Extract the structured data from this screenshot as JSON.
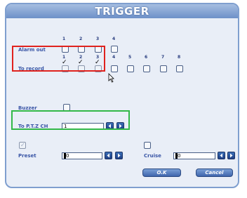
{
  "dialog": {
    "title": "TRIGGER"
  },
  "alarm_out": {
    "label": "Alarm out",
    "channels": [
      "1",
      "2",
      "3",
      "4"
    ]
  },
  "to_record": {
    "label": "To record",
    "channels": [
      "1",
      "2",
      "3",
      "4",
      "5",
      "6",
      "7",
      "8"
    ],
    "checked": [
      "1",
      "2",
      "3"
    ]
  },
  "buzzer": {
    "label": "Buzzer"
  },
  "ptz": {
    "label": "To P.T.Z CH",
    "value": "1"
  },
  "preset": {
    "label": "Preset",
    "value": "0"
  },
  "cruise": {
    "label": "Cruise",
    "value": "0"
  },
  "buttons": {
    "ok": "O.K",
    "cancel": "Cancel"
  },
  "colors": {
    "highlight_red": "#e0221e",
    "highlight_green": "#33b848",
    "dialog_border": "#7f9fcf",
    "label_blue": "#3a56a6"
  },
  "icons": {
    "prev": "arrow-left-icon",
    "next": "arrow-right-icon",
    "check": "check-icon"
  }
}
